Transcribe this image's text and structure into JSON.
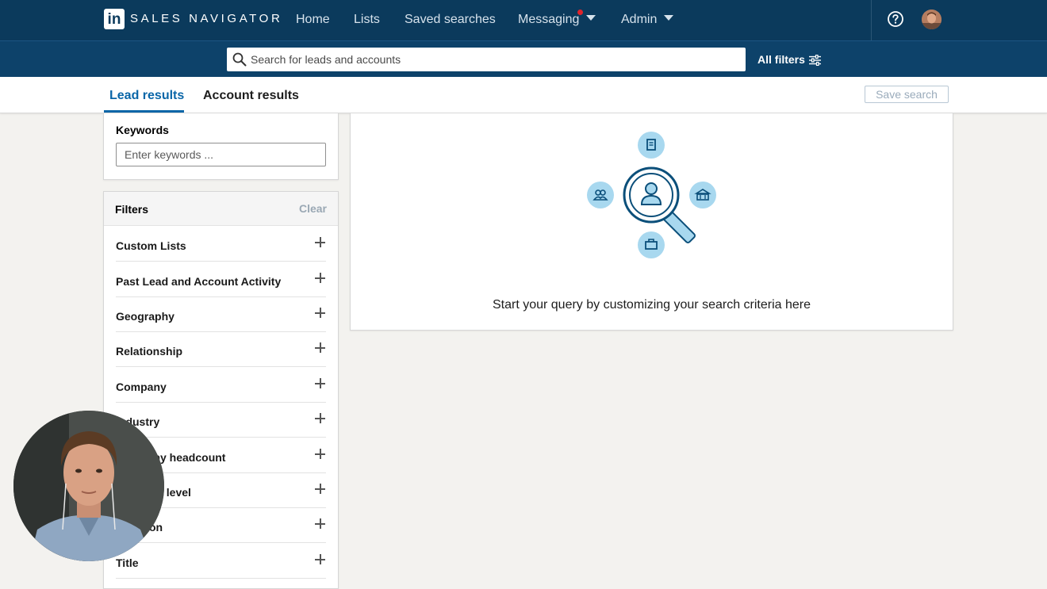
{
  "brand": {
    "logo_text": "in",
    "name": "SALES NAVIGATOR"
  },
  "nav": {
    "home": "Home",
    "lists": "Lists",
    "saved_searches": "Saved searches",
    "messaging": "Messaging",
    "admin": "Admin"
  },
  "search": {
    "placeholder": "Search for leads and accounts",
    "all_filters": "All filters"
  },
  "tabs": {
    "lead_results": "Lead results",
    "account_results": "Account results",
    "save_search": "Save search"
  },
  "keywords": {
    "title": "Keywords",
    "placeholder": "Enter keywords ..."
  },
  "filters": {
    "title": "Filters",
    "clear": "Clear",
    "items": [
      "Custom Lists",
      "Past Lead and Account Activity",
      "Geography",
      "Relationship",
      "Company",
      "Industry",
      "Company headcount",
      "Seniority level",
      "Function",
      "Title"
    ]
  },
  "empty_state": {
    "message": "Start your query by customizing your search criteria here"
  },
  "colors": {
    "nav_bg": "#0b3a5c",
    "search_bg": "#0d426a",
    "accent": "#0a66a8",
    "illustration_bubble": "#a8d8ef"
  }
}
